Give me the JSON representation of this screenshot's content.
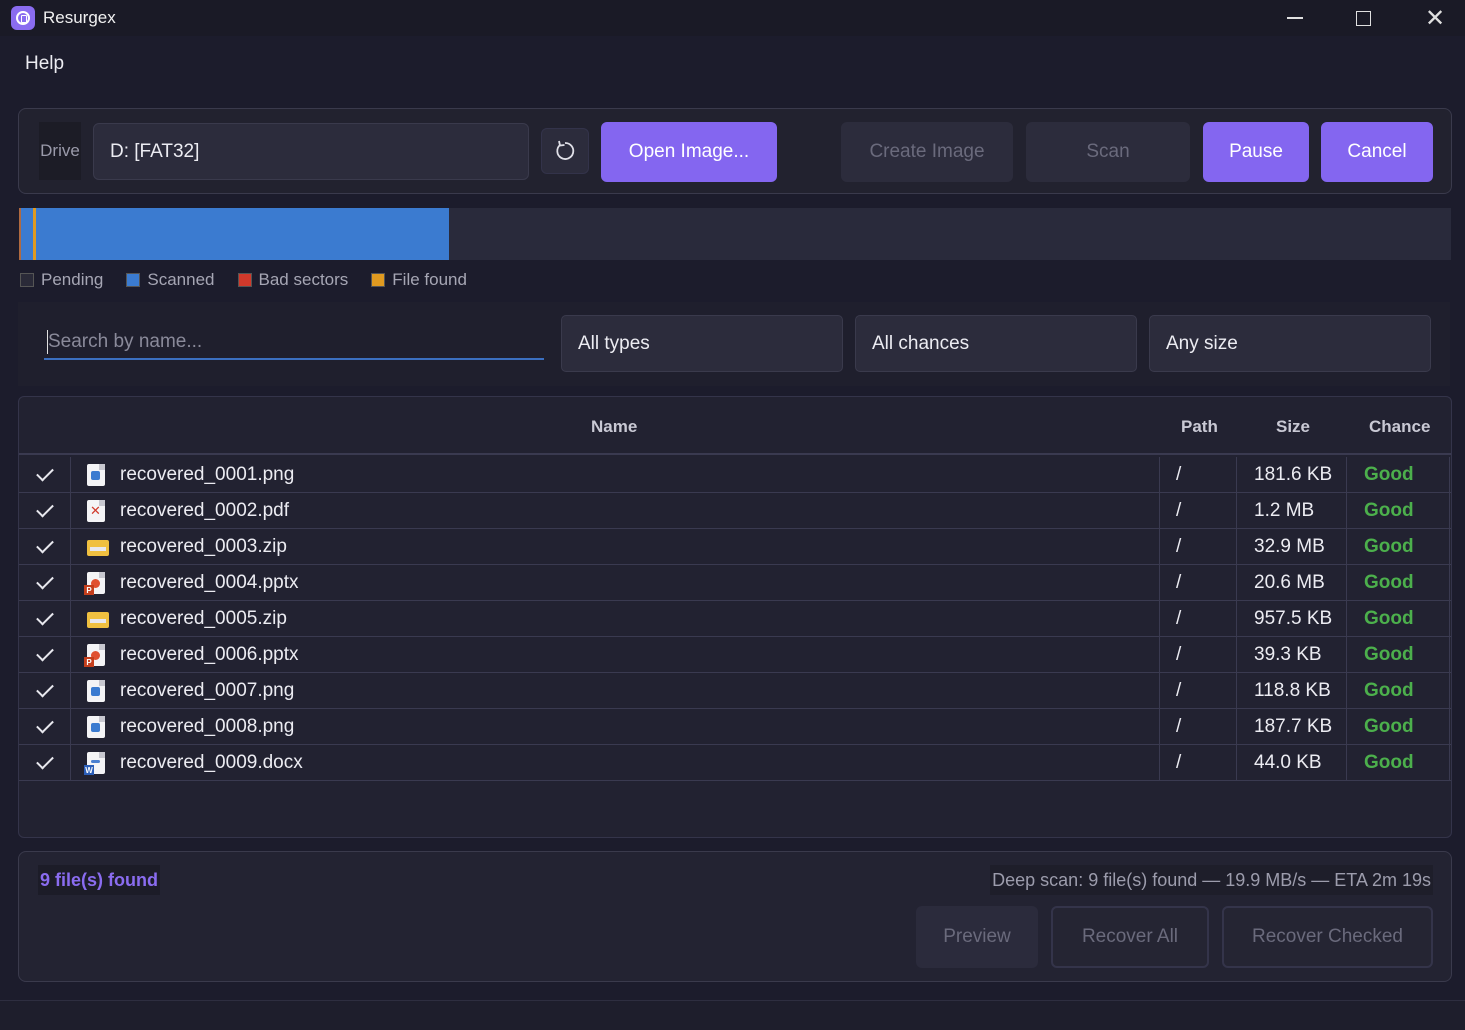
{
  "window": {
    "title": "Resurgex"
  },
  "menu": {
    "help": "Help"
  },
  "toolbar": {
    "drive_label": "Drive",
    "drive_value": "D:  [FAT32]",
    "open_image": "Open Image...",
    "create_image": "Create Image",
    "scan": "Scan",
    "pause": "Pause",
    "cancel": "Cancel"
  },
  "scan_map": {
    "scanned_fraction": 0.3,
    "legend": [
      {
        "label": "Pending",
        "color": "#2a2a38"
      },
      {
        "label": "Scanned",
        "color": "#3b7bd0"
      },
      {
        "label": "Bad sectors",
        "color": "#d0392b"
      },
      {
        "label": "File found",
        "color": "#e09a20"
      }
    ]
  },
  "filters": {
    "search_placeholder": "Search by name...",
    "types": "All types",
    "chances": "All chances",
    "size": "Any size"
  },
  "table": {
    "headers": {
      "name": "Name",
      "path": "Path",
      "size": "Size",
      "chance": "Chance"
    },
    "rows": [
      {
        "name": "recovered_0001.png",
        "icon": "png-file-icon",
        "path": "/",
        "size": "181.6 KB",
        "chance": "Good"
      },
      {
        "name": "recovered_0002.pdf",
        "icon": "pdf-file-icon",
        "path": "/",
        "size": "1.2 MB",
        "chance": "Good"
      },
      {
        "name": "recovered_0003.zip",
        "icon": "zip-file-icon",
        "path": "/",
        "size": "32.9 MB",
        "chance": "Good"
      },
      {
        "name": "recovered_0004.pptx",
        "icon": "pptx-file-icon",
        "path": "/",
        "size": "20.6 MB",
        "chance": "Good"
      },
      {
        "name": "recovered_0005.zip",
        "icon": "zip-file-icon",
        "path": "/",
        "size": "957.5 KB",
        "chance": "Good"
      },
      {
        "name": "recovered_0006.pptx",
        "icon": "pptx-file-icon",
        "path": "/",
        "size": "39.3 KB",
        "chance": "Good"
      },
      {
        "name": "recovered_0007.png",
        "icon": "png-file-icon",
        "path": "/",
        "size": "118.8 KB",
        "chance": "Good"
      },
      {
        "name": "recovered_0008.png",
        "icon": "png-file-icon",
        "path": "/",
        "size": "187.7 KB",
        "chance": "Good"
      },
      {
        "name": "recovered_0009.docx",
        "icon": "docx-file-icon",
        "path": "/",
        "size": "44.0 KB",
        "chance": "Good"
      }
    ]
  },
  "footer": {
    "files_found": "9 file(s) found",
    "status": "Deep scan: 9 file(s) found  —  19.9 MB/s  —  ETA 2m 19s",
    "preview": "Preview",
    "recover_all": "Recover All",
    "recover_checked": "Recover Checked"
  },
  "colors": {
    "accent": "#8466f0",
    "good": "#4cb04c"
  }
}
